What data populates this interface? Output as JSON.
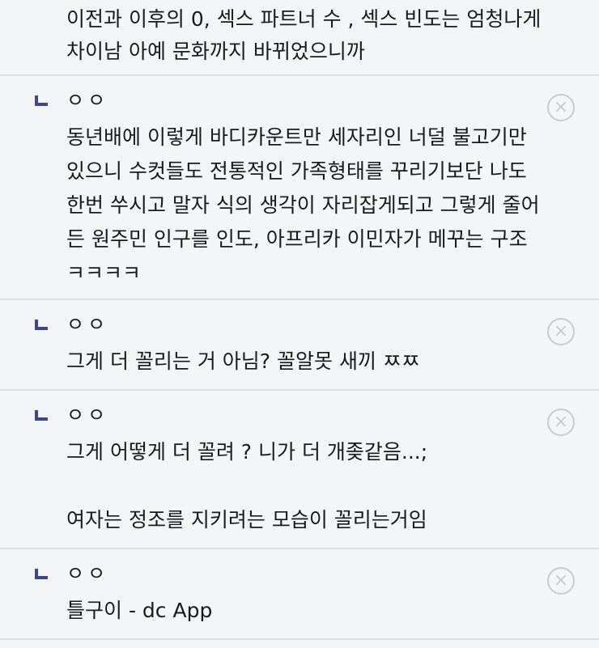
{
  "top_comment": {
    "lines": [
      "이전과 이후의 0, 섹스 파트너 수 , 섹스 빈도는 엄청나게",
      "차이남 아예 문화까지 바뀌었으니까"
    ]
  },
  "replies": [
    {
      "author": "ㅇㅇ",
      "delete_icon": "×",
      "lines": [
        "동년배에 이렇게 바디카운트만 세자리인 너덜 불고기만",
        "있으니 수컷들도 전통적인 가족형태를 꾸리기보단 나도",
        "한번 쑤시고 말자 식의 생각이 자리잡게되고 그렇게 줄어",
        "든 원주민 인구를 인도, 아프리카 이민자가 메꾸는 구조",
        "ㅋㅋㅋㅋ"
      ]
    },
    {
      "author": "ㅇㅇ",
      "delete_icon": "×",
      "lines": [
        "그게 더 꼴리는 거 아님? 꼴알못 새끼 ㅉㅉ"
      ]
    },
    {
      "author": "ㅇㅇ",
      "delete_icon": "×",
      "lines": [
        "그게 어떻게 더 꼴려 ? 니가 더 개좆같음...;",
        "",
        "여자는 정조를 지키려는 모습이 꼴리는거임"
      ]
    },
    {
      "author": "ㅇㅇ",
      "delete_icon": "×",
      "lines": [
        "틀구이 - dc App"
      ]
    }
  ]
}
